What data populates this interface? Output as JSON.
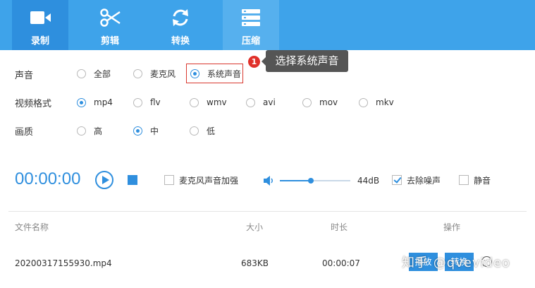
{
  "toolbar": {
    "tools": [
      {
        "label": "录制",
        "icon": "video-camera-icon"
      },
      {
        "label": "剪辑",
        "icon": "scissors-icon"
      },
      {
        "label": "转换",
        "icon": "refresh-icon"
      },
      {
        "label": "压缩",
        "icon": "compress-icon"
      }
    ],
    "active_index": 0,
    "colors": {
      "bar": "#3ea3ea",
      "active": "#2e8fde"
    }
  },
  "settings": {
    "audio": {
      "label": "声音",
      "options": [
        "全部",
        "麦克风",
        "系统声音"
      ],
      "selected": "系统声音"
    },
    "format": {
      "label": "视频格式",
      "options": [
        "mp4",
        "flv",
        "wmv",
        "avi",
        "mov",
        "mkv"
      ],
      "selected": "mp4"
    },
    "quality": {
      "label": "画质",
      "options": [
        "高",
        "中",
        "低"
      ],
      "selected": "中"
    }
  },
  "annotation": {
    "step": "1",
    "tooltip": "选择系统声音"
  },
  "player": {
    "time": "00:00:00",
    "mic_boost_label": "麦克风声音加强",
    "mic_boost_checked": false,
    "volume_level": 0.44,
    "volume_text": "44dB",
    "denoise_label": "去除噪声",
    "denoise_checked": true,
    "mute_label": "静音",
    "mute_checked": false
  },
  "files": {
    "columns": [
      "文件名称",
      "大小",
      "时长",
      "操作"
    ],
    "rows": [
      {
        "name": "20200317155930.mp4",
        "size": "683KB",
        "duration": "00:00:07"
      }
    ],
    "actions": [
      "播放",
      "转换",
      "更多"
    ]
  },
  "watermark": "知乎 @qvevideo",
  "accent_color": "#2f8fde"
}
